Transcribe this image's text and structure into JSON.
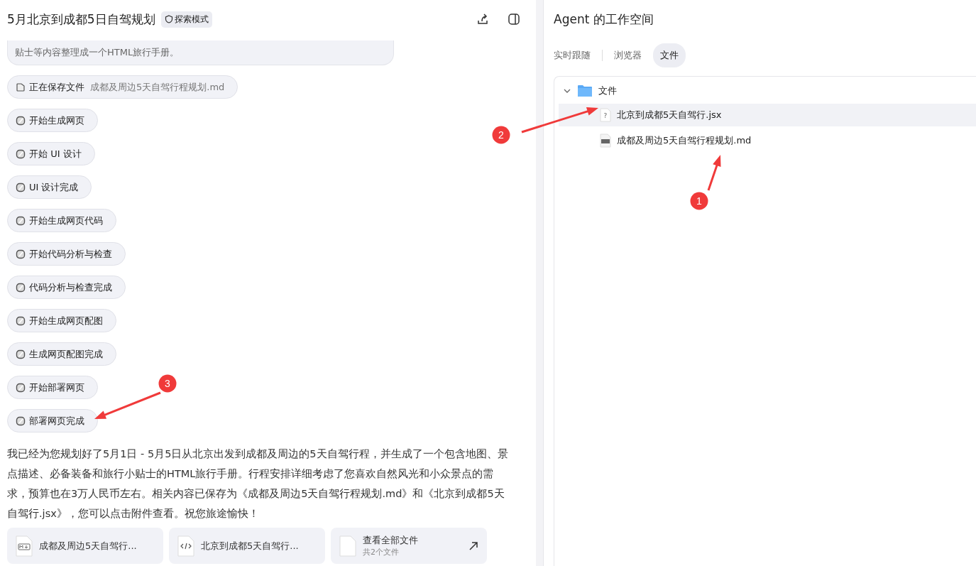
{
  "header": {
    "title": "5月北京到成都5日自驾规划",
    "mode_badge": "探索模式"
  },
  "chat": {
    "truncated_message": "贴士等内容整理成一个HTML旅行手册。",
    "saving_step": {
      "label": "正在保存文件",
      "file": "成都及周边5天自驾行程规划.md"
    },
    "steps": [
      "开始生成网页",
      "开始 UI 设计",
      "UI 设计完成",
      "开始生成网页代码",
      "开始代码分析与检查",
      "代码分析与检查完成",
      "开始生成网页配图",
      "生成网页配图完成",
      "开始部署网页",
      "部署网页完成"
    ],
    "reply": "我已经为您规划好了5月1日 - 5月5日从北京出发到成都及周边的5天自驾行程，并生成了一个包含地图、景点描述、必备装备和旅行小贴士的HTML旅行手册。行程安排详细考虑了您喜欢自然风光和小众景点的需求，预算也在3万人民币左右。相关内容已保存为《成都及周边5天自驾行程规划.md》和《北京到成都5天自驾行.jsx》，您可以点击附件查看。祝您旅途愉快！",
    "attachments": [
      {
        "kind": "markdown",
        "name": "成都及周边5天自驾行..."
      },
      {
        "kind": "code",
        "name": "北京到成都5天自驾行..."
      },
      {
        "kind": "all",
        "name": "查看全部文件",
        "count": "共2个文件"
      }
    ]
  },
  "workspace": {
    "title": "Agent 的工作空间",
    "tabs": [
      {
        "label": "实时跟随",
        "selected": false
      },
      {
        "label": "浏览器",
        "selected": false
      },
      {
        "label": "文件",
        "selected": true
      }
    ],
    "folder": {
      "name": "文件",
      "expanded": true,
      "children": [
        {
          "kind": "unknown",
          "icon": "?",
          "name": "北京到成都5天自驾行.jsx",
          "selected": true
        },
        {
          "kind": "markdown",
          "name": "成都及周边5天自驾行程规划.md",
          "selected": false
        }
      ]
    }
  },
  "annotations": [
    {
      "number": "1"
    },
    {
      "number": "2"
    },
    {
      "number": "3"
    }
  ]
}
